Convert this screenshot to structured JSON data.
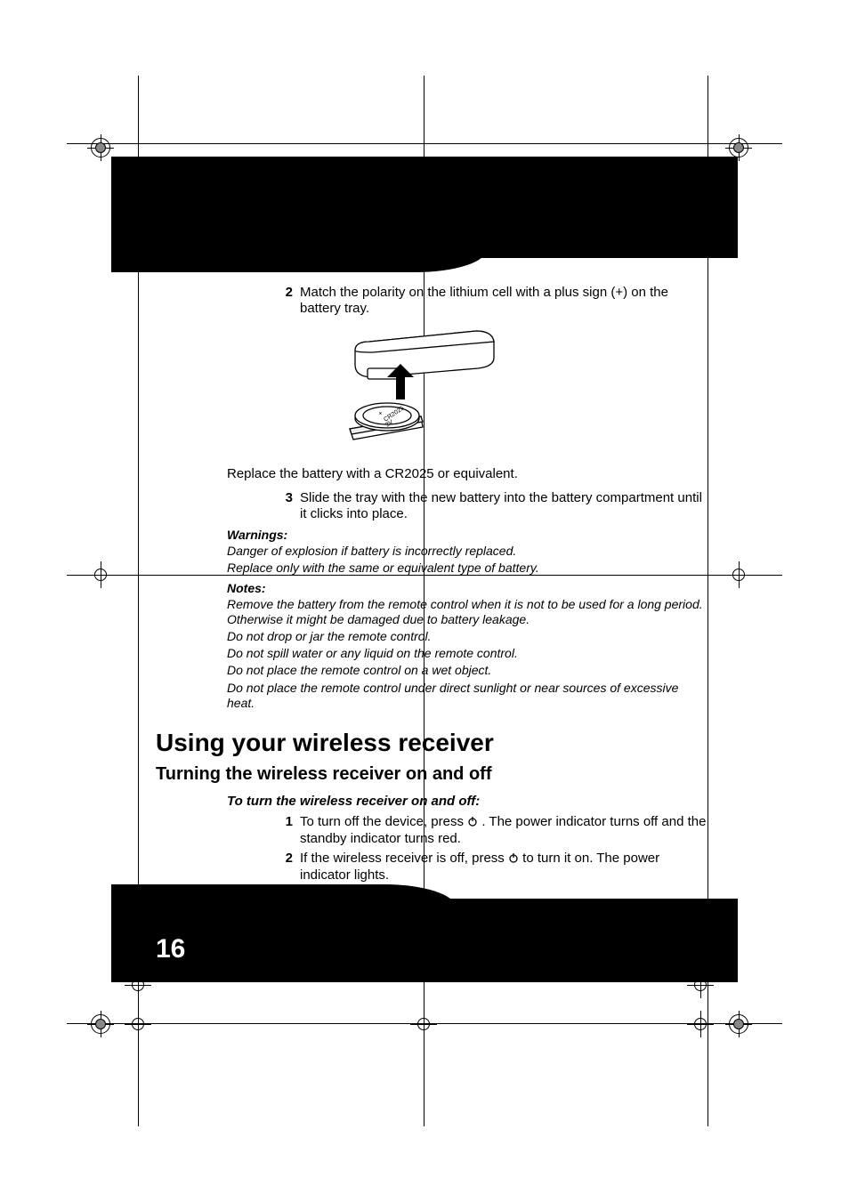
{
  "pageNumber": "16",
  "steps": {
    "s2_num": "2",
    "s2_text": "Match the polarity on the lithium cell with a plus sign (+) on the battery tray.",
    "replace_text": "Replace the battery with a CR2025 or equivalent.",
    "s3_num": "3",
    "s3_text": "Slide the tray with the new battery into the battery compartment until it clicks into place."
  },
  "warnings": {
    "head": "Warnings:",
    "lines": [
      "Danger of explosion if battery is incorrectly replaced.",
      "Replace only with the same or equivalent type of battery."
    ]
  },
  "notes": {
    "head": "Notes:",
    "lines": [
      "Remove the battery from the remote control when it is not to be used for a long period. Otherwise it might be damaged due to battery leakage.",
      "Do not drop or jar the remote control.",
      "Do not spill water or any liquid on the remote control.",
      "Do not place the remote control on a wet object.",
      "Do not place the remote control under direct sunlight or near sources of excessive heat."
    ]
  },
  "section_title": "Using your wireless receiver",
  "subsection_title": "Turning the wireless receiver on and off",
  "procedure": {
    "head": "To turn the wireless receiver on and off:",
    "p1_num": "1",
    "p1_a": "To turn off the device, press ",
    "p1_b": ". The power indicator turns off and the standby indicator turns red.",
    "p2_num": "2",
    "p2_a": "If the wireless receiver is off, press ",
    "p2_b": " to turn it on. The power indicator lights."
  },
  "battery_label": "CR2025 3V +"
}
